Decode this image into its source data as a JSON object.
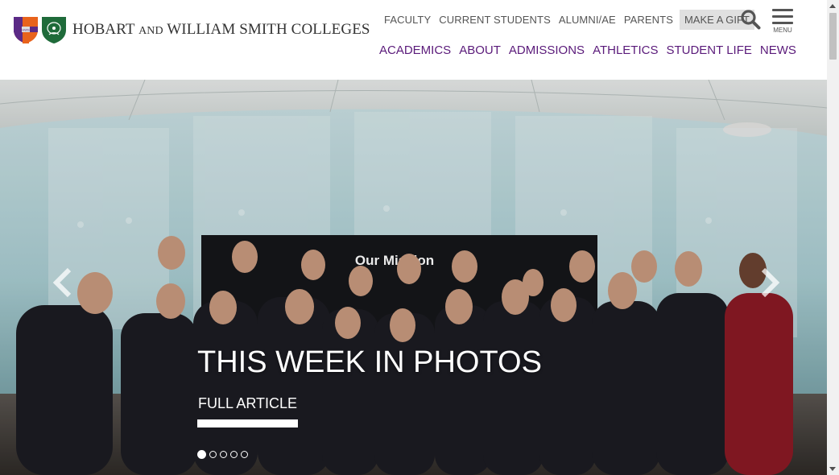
{
  "header": {
    "logo": {
      "name_part1": "HOBART",
      "and": "AND",
      "name_part2": "WILLIAM SMITH COLLEGES",
      "shield_icons": [
        "hobart-shield-icon",
        "william-smith-shield-icon"
      ]
    },
    "utility_nav": [
      "FACULTY",
      "CURRENT STUDENTS",
      "ALUMNI/AE",
      "PARENTS"
    ],
    "gift_label": "MAKE A GIFT",
    "search_icon": "search-icon",
    "menu_label": "MENU",
    "main_nav": [
      "ACADEMICS",
      "ABOUT",
      "ADMISSIONS",
      "ATHLETICS",
      "STUDENT LIFE",
      "NEWS"
    ]
  },
  "hero": {
    "slide_title": "THIS WEEK IN PHOTOS",
    "slide_link": "FULL ARTICLE",
    "screen_text": "Our Mission",
    "slide_count": 5,
    "active_slide": 1,
    "prev_icon": "chevron-left-icon",
    "next_icon": "chevron-right-icon"
  },
  "colors": {
    "nav_purple": "#5a1a7a",
    "utility_gray": "#555555",
    "gift_bg": "#e0e0e0",
    "hobart_orange": "#e8631c",
    "hobart_purple": "#5b2a86",
    "ws_green": "#1f6b3a"
  }
}
